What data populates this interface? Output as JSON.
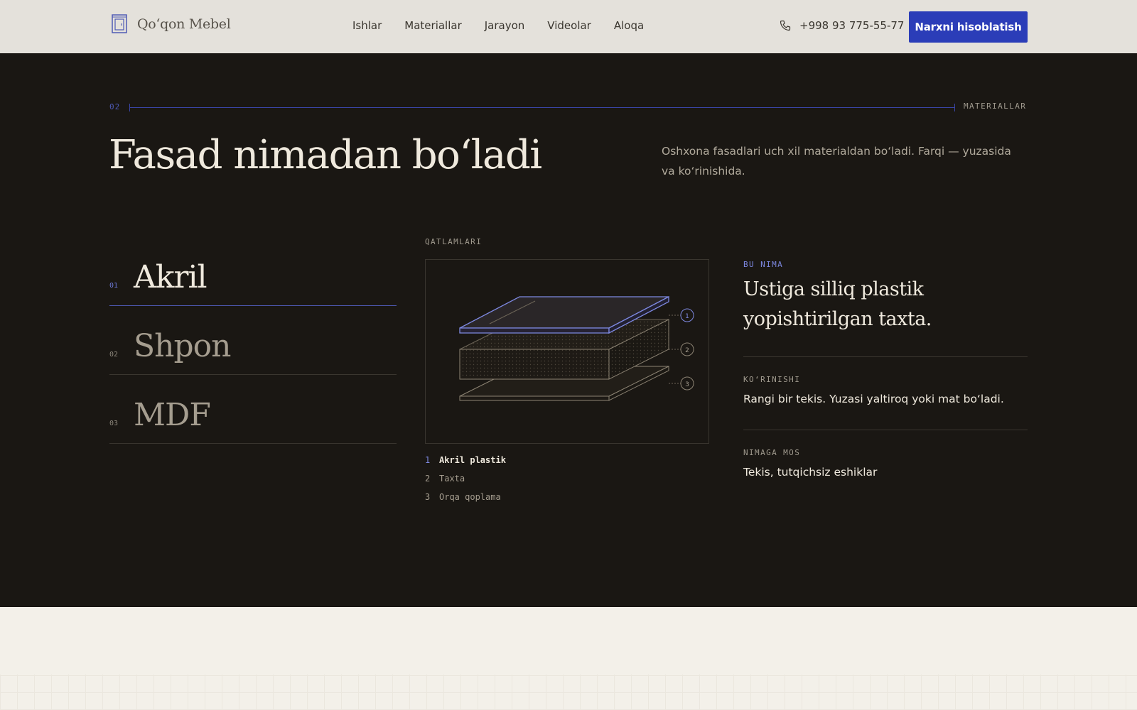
{
  "header": {
    "logo_text": "Qo‘qon Mebel",
    "nav": [
      "Ishlar",
      "Materiallar",
      "Jarayon",
      "Videolar",
      "Aloqa"
    ],
    "phone": "+998 93 775-55-77",
    "cta_label": "Narxni hisoblatish",
    "accent_color": "#2b3db8"
  },
  "section": {
    "number": "02",
    "label": "MATERIALLAR",
    "title": "Fasad nimadan bo‘ladi",
    "intro": "Oshxona fasadlari uch xil materialdan bo‘ladi. Farqi — yuzasida va ko‘rinishida."
  },
  "materials": [
    {
      "num": "01",
      "name": "Akril",
      "active": true
    },
    {
      "num": "02",
      "name": "Shpon",
      "active": false
    },
    {
      "num": "03",
      "name": "MDF",
      "active": false
    }
  ],
  "diagram": {
    "label": "QATLAMLARI",
    "markers": [
      "1",
      "2",
      "3"
    ],
    "layers": [
      {
        "num": "1",
        "name": "Akril plastik",
        "active": true
      },
      {
        "num": "2",
        "name": "Taxta",
        "active": false
      },
      {
        "num": "3",
        "name": "Orqa qoplama",
        "active": false
      }
    ]
  },
  "details": {
    "what_label": "BU NIMA",
    "what_text": "Ustiga silliq plastik yopishtirilgan taxta.",
    "look_label": "KO‘RINISHI",
    "look_text": "Rangi bir tekis. Yuzasi yaltiroq yoki mat bo‘ladi.",
    "fit_label": "NIMAGA MOS",
    "fit_text": "Tekis, tutqichsiz eshiklar"
  }
}
